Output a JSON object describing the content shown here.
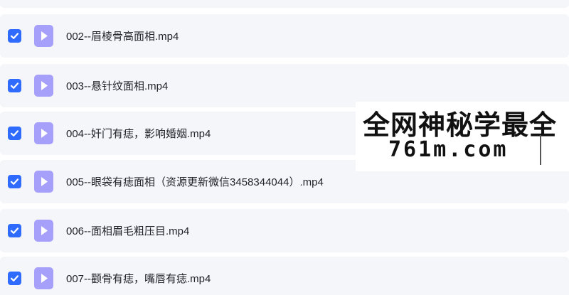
{
  "files": [
    {
      "name": "",
      "checked": true
    },
    {
      "name": "002--眉棱骨高面相.mp4",
      "checked": true
    },
    {
      "name": "003--悬针纹面相.mp4",
      "checked": true
    },
    {
      "name": "004--奸门有痣，影响婚姻.mp4",
      "checked": true
    },
    {
      "name": "005--眼袋有痣面相（资源更新微信3458344044）.mp4",
      "checked": true
    },
    {
      "name": "006--面相眉毛粗压目.mp4",
      "checked": true
    },
    {
      "name": "007--颧骨有痣，嘴唇有痣.mp4",
      "checked": true
    }
  ],
  "watermark": {
    "line1": "全网神秘学最全",
    "line2": "761m.com"
  },
  "colors": {
    "checkbox": "#2f6bff",
    "file_icon": "#a7a0fb",
    "row_bg": "#f5f6fa"
  }
}
